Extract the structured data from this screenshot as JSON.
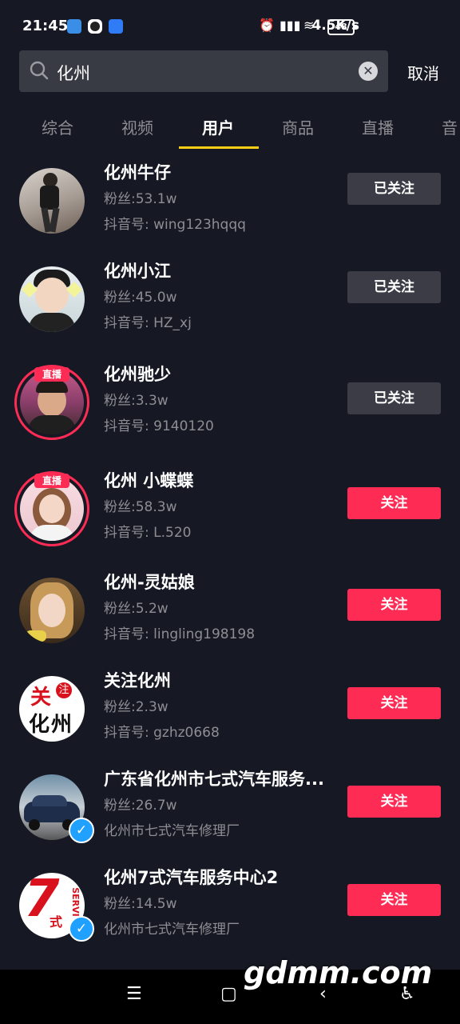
{
  "status_bar": {
    "time": "21:45",
    "speed": "4.5K/s",
    "battery": "48"
  },
  "search": {
    "query": "化州",
    "cancel_label": "取消"
  },
  "tabs": [
    {
      "label": "综合",
      "active": false
    },
    {
      "label": "视频",
      "active": false
    },
    {
      "label": "用户",
      "active": true
    },
    {
      "label": "商品",
      "active": false
    },
    {
      "label": "直播",
      "active": false
    },
    {
      "label": "音",
      "active": false
    }
  ],
  "users": [
    {
      "name": "化州牛仔",
      "fans": "粉丝:53.1w",
      "id": "抖音号: wing123hqqq",
      "button": "已关注",
      "followed": true,
      "live": false,
      "verified": false
    },
    {
      "name": "化州小江",
      "fans": "粉丝:45.0w",
      "id": "抖音号: HZ_xj",
      "button": "已关注",
      "followed": true,
      "live": false,
      "verified": false
    },
    {
      "name": "化州驰少",
      "fans": "粉丝:3.3w",
      "id": "抖音号: 9140120",
      "button": "已关注",
      "followed": true,
      "live": true,
      "verified": false
    },
    {
      "name": "化州 小蝶蝶",
      "fans": "粉丝:58.3w",
      "id": "抖音号: L.520",
      "button": "关注",
      "followed": false,
      "live": true,
      "verified": false
    },
    {
      "name": "化州-灵姑娘",
      "fans": "粉丝:5.2w",
      "id": "抖音号: lingling198198",
      "button": "关注",
      "followed": false,
      "live": false,
      "verified": false
    },
    {
      "name": "关注化州",
      "fans": "粉丝:2.3w",
      "id": "抖音号: gzhz0668",
      "button": "关注",
      "followed": false,
      "live": false,
      "verified": false
    },
    {
      "name": "广东省化州市七式汽车服务...",
      "fans": "粉丝:26.7w",
      "id": "化州市七式汽车修理厂",
      "button": "关注",
      "followed": false,
      "live": false,
      "verified": true
    },
    {
      "name": "化州7式汽车服务中心2",
      "fans": "粉丝:14.5w",
      "id": "化州市七式汽车修理厂",
      "button": "关注",
      "followed": false,
      "live": false,
      "verified": true
    }
  ],
  "live_badge": "直播",
  "avatar_logo_6": {
    "line1": "关",
    "small": "注",
    "line2": "化州"
  },
  "avatar_logo_8": {
    "big": "7",
    "small": "式",
    "side": "SERVI"
  },
  "watermark": "gdmm.com"
}
